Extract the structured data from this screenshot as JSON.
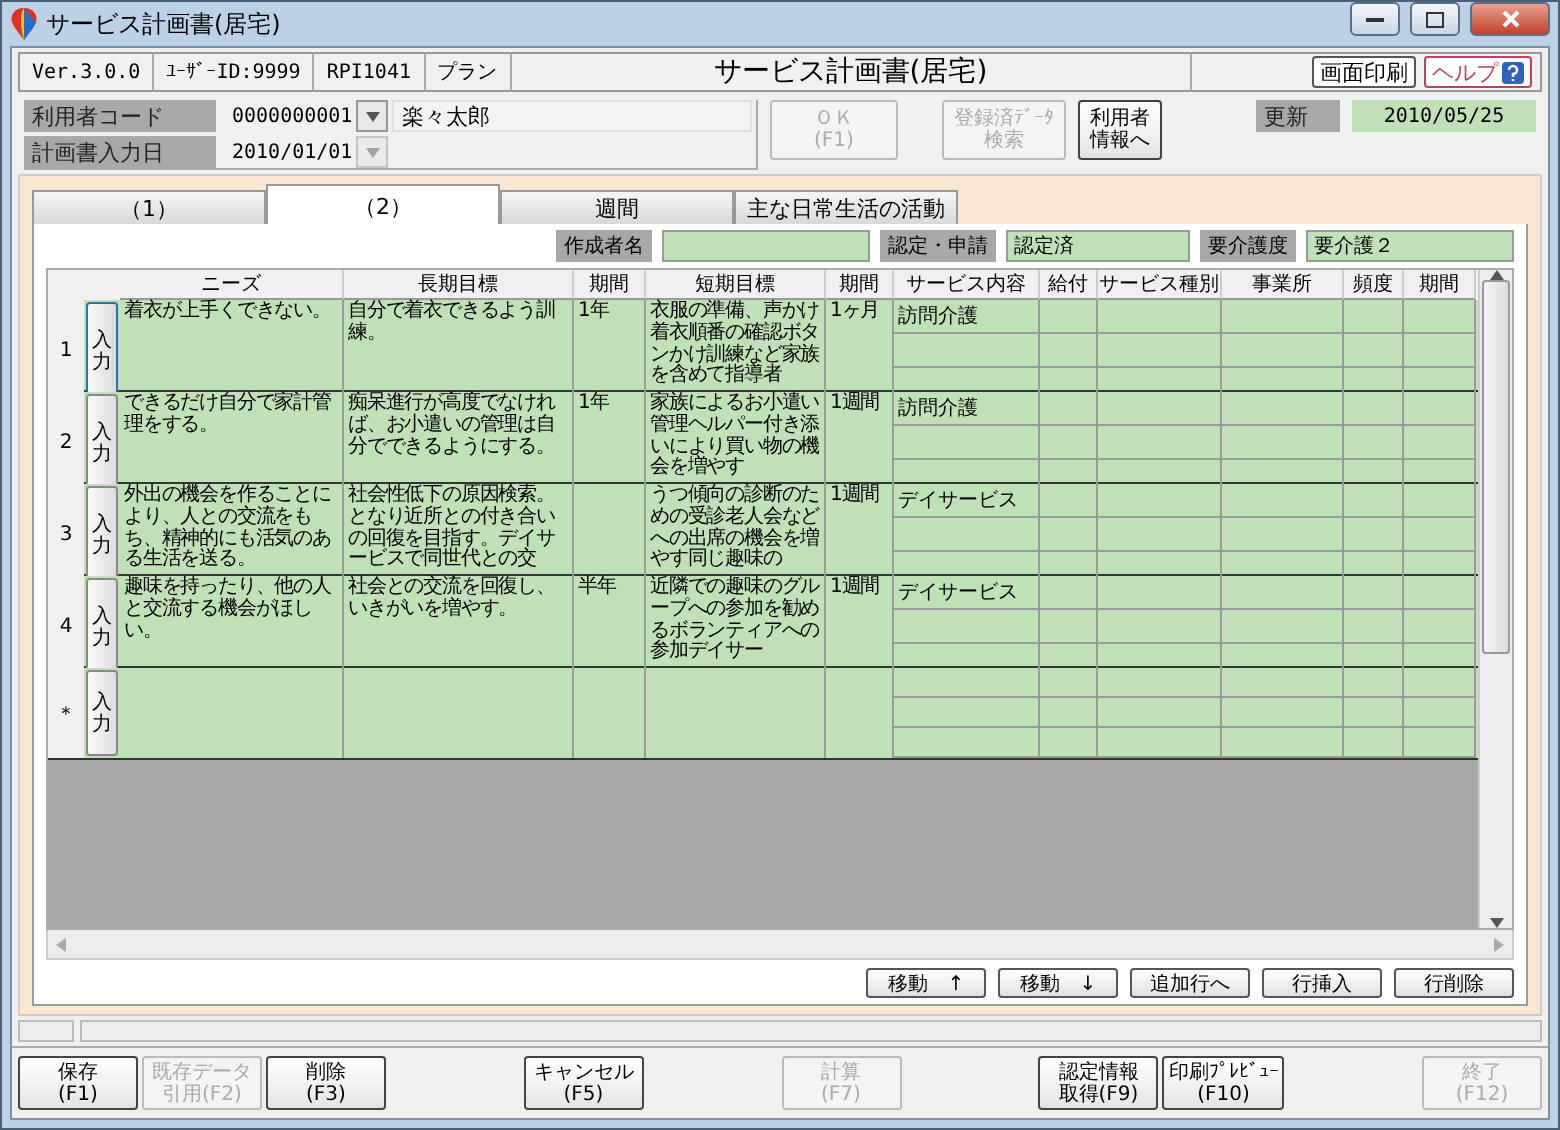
{
  "window": {
    "title": "サービス計画書(居宅)"
  },
  "header": {
    "cells": [
      "Ver.3.0.0",
      "ﾕｰｻﾞｰID:9999",
      "RPI1041",
      "プラン"
    ],
    "title": "サービス計画書(居宅)",
    "buttons": [
      {
        "label": "画面印刷",
        "kind": "plain"
      },
      {
        "label": "ヘルプ",
        "kind": "help"
      }
    ]
  },
  "user": {
    "code_label": "利用者コード",
    "code": "0000000001",
    "name": "楽々太郎",
    "date_label": "計画書入力日",
    "date": "2010/01/01",
    "buttons": [
      {
        "lines": [
          "ＯＫ",
          "(F1)"
        ],
        "disabled": true
      },
      {
        "lines": [
          "登録済ﾃﾞｰﾀ",
          "検索"
        ],
        "disabled": true
      },
      {
        "lines": [
          "利用者",
          "情報へ"
        ],
        "disabled": false
      }
    ],
    "updated_label": "更新",
    "updated": "2010/05/25"
  },
  "tabs": [
    {
      "label": "（1）",
      "selected": false
    },
    {
      "label": "（2）",
      "selected": true
    },
    {
      "label": "週間",
      "selected": false
    },
    {
      "label": "主な日常生活の活動",
      "selected": false
    }
  ],
  "info": [
    {
      "label": "作成者名"
    },
    {
      "label": "認定・申請",
      "value": "認定済"
    },
    {
      "label": "要介護度",
      "value": "要介護２"
    }
  ],
  "table": {
    "columns": [
      "ニーズ",
      "長期目標",
      "期間",
      "短期目標",
      "期間",
      "サービス内容",
      "給付",
      "サービス種別",
      "事業所",
      "頻度",
      "期間"
    ],
    "rows": [
      {
        "number": "1",
        "input": "入力",
        "focused": true,
        "needs": "着衣が上手くできない。",
        "long_goal": "自分で着衣できるよう訓練。",
        "long_period": "1年",
        "short_goal": "衣服の準備、声かけ着衣順番の確認ボタンかけ訓練など家族を含めて指導者",
        "short_period": "1ヶ月",
        "service": "訪問介護"
      },
      {
        "number": "2",
        "input": "入力",
        "focused": false,
        "needs": "できるだけ自分で家計管理をする。",
        "long_goal": "痴呆進行が高度でなければ、お小遣いの管理は自分でできるようにする。",
        "long_period": "1年",
        "short_goal": "家族によるお小遣い管理ヘルパー付き添いにより買い物の機会を増やす",
        "short_period": "1週間",
        "service": "訪問介護"
      },
      {
        "number": "3",
        "input": "入力",
        "focused": false,
        "needs": "外出の機会を作ることにより、人との交流をもち、精神的にも活気のある生活を送る。",
        "long_goal": "社会性低下の原因検索。となり近所との付き合いの回復を目指す。デイサービスで同世代との交",
        "short_goal": "うつ傾向の診断のための受診老人会などへの出席の機会を増やす同じ趣味の",
        "short_period": "1週間",
        "service": "デイサービス"
      },
      {
        "number": "4",
        "input": "入力",
        "focused": false,
        "needs": "趣味を持ったり、他の人と交流する機会がほしい。",
        "long_goal": "社会との交流を回復し、いきがいを増やす。",
        "long_period": "半年",
        "short_goal": "近隣での趣味のグループへの参加を勧めるボランティアへの参加デイサー",
        "short_period": "1週間",
        "service": "デイサービス"
      },
      {
        "number": "＊",
        "input": "入力",
        "focused": false
      }
    ]
  },
  "actions": [
    "移動　↑",
    "移動　↓",
    "追加行へ",
    "行挿入",
    "行削除"
  ],
  "footer": [
    [
      {
        "lines": [
          "保存",
          "(F1)"
        ],
        "disabled": false
      },
      {
        "lines": [
          "既存データ",
          "引用(F2)"
        ],
        "disabled": true
      },
      {
        "lines": [
          "削除",
          "(F3)"
        ],
        "disabled": false
      }
    ],
    [
      {
        "lines": [
          "キャンセル",
          "(F5)"
        ],
        "disabled": false
      }
    ],
    [
      {
        "lines": [
          "計算",
          "(F7)"
        ],
        "disabled": true
      }
    ],
    [
      {
        "lines": [
          "認定情報",
          "取得(F9)"
        ],
        "disabled": false
      },
      {
        "lines": [
          "印刷ﾌﾟﾚﾋﾞｭｰ",
          "(F10)"
        ],
        "disabled": false
      }
    ],
    [
      {
        "lines": [
          "終了",
          "(F12)"
        ],
        "disabled": true
      }
    ]
  ]
}
